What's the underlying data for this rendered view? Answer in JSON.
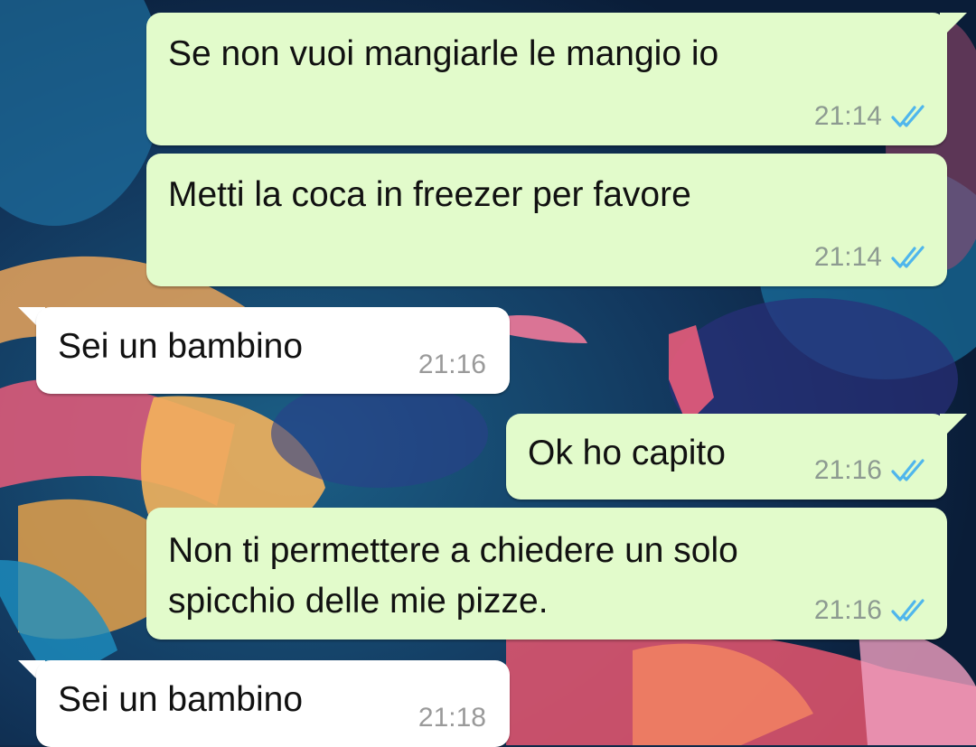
{
  "colors": {
    "outgoing_bubble": "#e2fbcb",
    "incoming_bubble": "#ffffff",
    "read_tick": "#4fb6ec",
    "timestamp": "#8d9a91"
  },
  "messages": [
    {
      "direction": "outgoing",
      "text": "Se non vuoi mangiarle le mangio io",
      "time": "21:14",
      "status_icon": "double-check-read-icon"
    },
    {
      "direction": "outgoing",
      "text": "Metti la coca in freezer per favore",
      "time": "21:14",
      "status_icon": "double-check-read-icon"
    },
    {
      "direction": "incoming",
      "text": "Sei un bambino",
      "time": "21:16"
    },
    {
      "direction": "outgoing",
      "text": "Ok ho capito",
      "time": "21:16",
      "status_icon": "double-check-read-icon"
    },
    {
      "direction": "outgoing",
      "lines": [
        "Non ti permettere a chiedere un solo",
        "spicchio delle mie pizze."
      ],
      "time": "21:16",
      "status_icon": "double-check-read-icon"
    },
    {
      "direction": "incoming",
      "text": "Sei un bambino",
      "time": "21:18"
    }
  ]
}
